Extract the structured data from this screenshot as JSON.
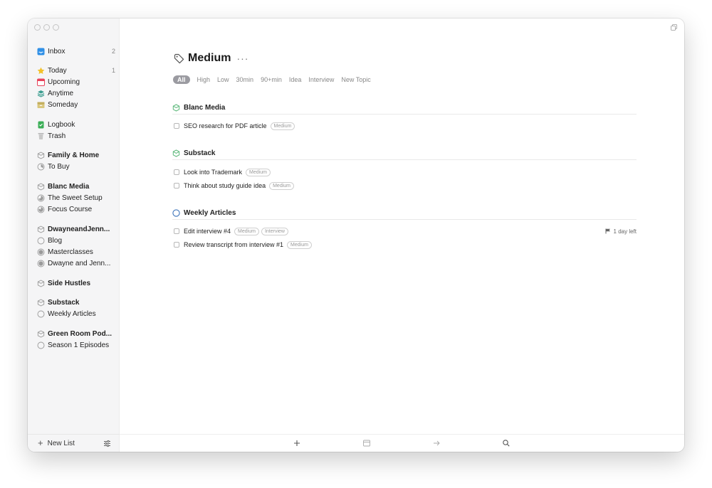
{
  "sidebar": {
    "inbox": {
      "label": "Inbox",
      "count": "2"
    },
    "today": {
      "label": "Today",
      "count": "1"
    },
    "upcoming": {
      "label": "Upcoming"
    },
    "anytime": {
      "label": "Anytime"
    },
    "someday": {
      "label": "Someday"
    },
    "logbook": {
      "label": "Logbook"
    },
    "trash": {
      "label": "Trash"
    },
    "areas": [
      {
        "label": "Family & Home",
        "projects": [
          "To Buy"
        ]
      },
      {
        "label": "Blanc Media",
        "projects": [
          "The Sweet Setup",
          "Focus Course"
        ]
      },
      {
        "label": "DwayneandJenn...",
        "projects": [
          "Blog",
          "Masterclasses",
          "Dwayne and Jenn..."
        ]
      },
      {
        "label": "Side Hustles",
        "projects": []
      },
      {
        "label": "Substack",
        "projects": [
          "Weekly Articles"
        ]
      },
      {
        "label": "Green Room Pod...",
        "projects": [
          "Season 1 Episodes"
        ]
      }
    ],
    "new_list_label": "New List"
  },
  "main": {
    "title": "Medium",
    "more": "···",
    "filters": [
      "All",
      "High",
      "Low",
      "30min",
      "90+min",
      "Idea",
      "Interview",
      "New Topic"
    ],
    "active_filter": "All",
    "sections": [
      {
        "name": "Blanc Media",
        "todos": [
          {
            "text": "SEO research for PDF article",
            "tags": [
              "Medium"
            ]
          }
        ]
      },
      {
        "name": "Substack",
        "todos": [
          {
            "text": "Look into Trademark",
            "tags": [
              "Medium"
            ]
          },
          {
            "text": "Think about study guide idea",
            "tags": [
              "Medium"
            ]
          }
        ]
      },
      {
        "name": "Weekly Articles",
        "todos": [
          {
            "text": "Edit interview #4",
            "tags": [
              "Medium",
              "Interview"
            ],
            "deadline": "1 day left"
          },
          {
            "text": "Review transcript from interview #1",
            "tags": [
              "Medium"
            ]
          }
        ]
      }
    ]
  },
  "colors": {
    "inbox": "#2f8fe6",
    "today": "#f3c12a",
    "upcoming": "#e8435a",
    "anytime": "#3a9d8f",
    "someday": "#c9b469",
    "logbook": "#3cae57",
    "area_icon": "#5cb87a",
    "project_ring": "#3c73b9"
  }
}
